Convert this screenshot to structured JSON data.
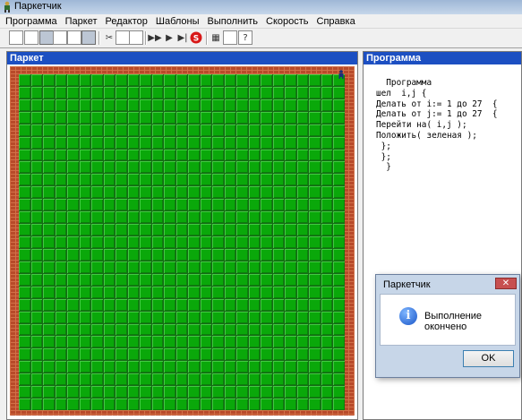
{
  "window": {
    "title": "Паркетчик"
  },
  "menu": [
    "Программа",
    "Паркет",
    "Редактор",
    "Шаблоны",
    "Выполнить",
    "Скорость",
    "Справка"
  ],
  "toolbar": {
    "help_label": "?",
    "stop_label": "S",
    "buttons": [
      "new",
      "open",
      "save",
      "cut",
      "copy",
      "paste",
      "run",
      "step",
      "stop",
      "help"
    ]
  },
  "left_panel": {
    "title": "Паркет"
  },
  "parquet": {
    "rows": 27,
    "cols": 27,
    "tile_color": "#0aa80a",
    "border_color": "#b84a2a"
  },
  "right_panel": {
    "title": "Программа",
    "code_lines": [
      "  Программа",
      "шел  i,j {",
      "Делать от i:= 1 до 27  {",
      "Делать от j:= 1 до 27  {",
      "Перейти на( i,j );",
      "Положить( зеленая );",
      " };",
      " };",
      "  }"
    ]
  },
  "dialog": {
    "title": "Паркетчик",
    "message": "Выполнение окончено",
    "ok_label": "OK",
    "close_label": "✕",
    "icon_glyph": "i"
  }
}
